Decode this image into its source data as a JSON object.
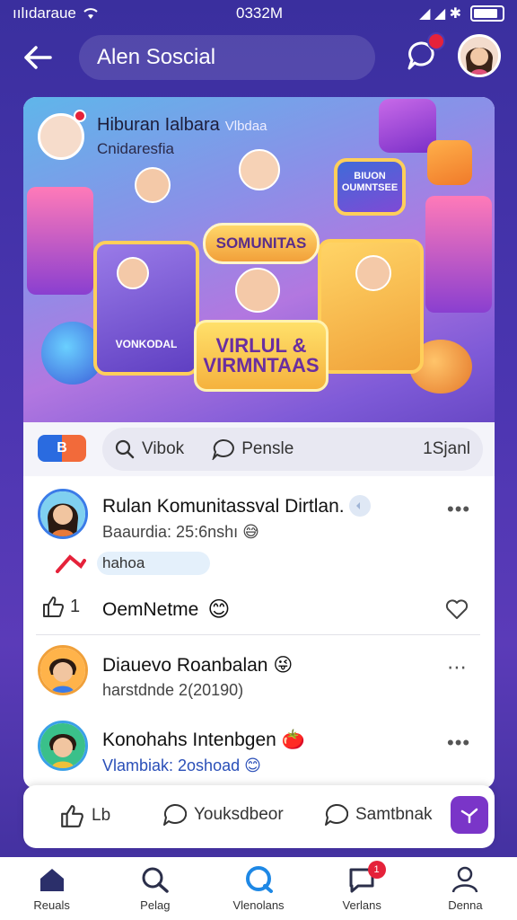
{
  "status_bar": {
    "carrier": "ıılıdaraue",
    "time": "0332M",
    "right_glyphs": "◢ ◢ ✱"
  },
  "header": {
    "title": "Alen Soscial"
  },
  "banner": {
    "title": "Hiburan Ialbara",
    "title_suffix": "Vlbdaa",
    "subtitle": "Cnidaresfia",
    "sign_main": "SOMUNITAS",
    "sign_virtual": "VIRLUL & VIRMNTAAS",
    "panel_left_label": "VONKODAL",
    "panel_right_label": "",
    "panel_top_label": "BIUON OUMNTSEE"
  },
  "search": {
    "logo": "B",
    "query": "Vibok",
    "people": "Pensle",
    "count": "1Sjanl"
  },
  "posts": [
    {
      "name": "Rulan Komunitassval Dirtlan.",
      "meta": "Baaurdia: 25:6nshı",
      "tag": "hahoa",
      "reaction_count": "1",
      "reaction_label": "OemNetme"
    },
    {
      "name": "Diauevo Roanbalan",
      "meta": "harstdnde 2(20190)"
    },
    {
      "name": "Konohahs Intenbgen",
      "meta": "Vlambiak: 2oshoad"
    }
  ],
  "actions": {
    "like": "Lb",
    "comment": "Youksdbeor",
    "share": "Samtbnak"
  },
  "tabs": [
    {
      "label": "Reuals",
      "icon": "home-icon"
    },
    {
      "label": "Pelag",
      "icon": "search-icon"
    },
    {
      "label": "Vlenolans",
      "icon": "chat-icon"
    },
    {
      "label": "Verlans",
      "icon": "message-icon",
      "badge": "1"
    },
    {
      "label": "Denna",
      "icon": "profile-icon"
    }
  ],
  "colors": {
    "background": "#4a35b0",
    "accent": "#7a35c8",
    "notification": "#e5223a",
    "active_tab": "#1e88e5"
  }
}
